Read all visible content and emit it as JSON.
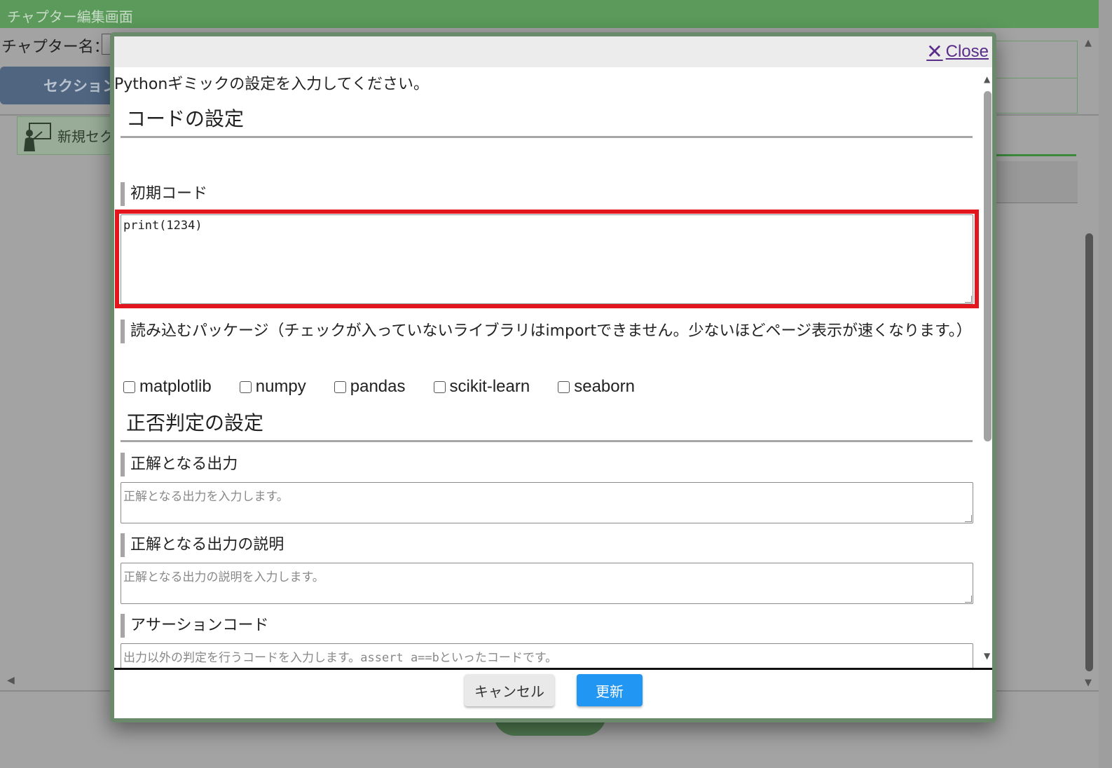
{
  "background": {
    "title": "チャプター編集画面",
    "chapter_name_label": "チャプター名：",
    "section_button": "セクション",
    "section_item": "新規セク"
  },
  "modal": {
    "close_label": "Close",
    "intro": "Pythonギミックの設定を入力してください。",
    "code_section": {
      "heading": "コードの設定",
      "initial_code_label": "初期コード",
      "initial_code_value": "print(1234)",
      "packages_label": "読み込むパッケージ（チェックが入っていないライブラリはimportできません。少ないほどページ表示が速くなります。）",
      "packages": [
        {
          "name": "matplotlib",
          "checked": false
        },
        {
          "name": "numpy",
          "checked": false
        },
        {
          "name": "pandas",
          "checked": false
        },
        {
          "name": "scikit-learn",
          "checked": false
        },
        {
          "name": "seaborn",
          "checked": false
        }
      ]
    },
    "judge_section": {
      "heading": "正否判定の設定",
      "expected_output_label": "正解となる出力",
      "expected_output_placeholder": "正解となる出力を入力します。",
      "expected_output_desc_label": "正解となる出力の説明",
      "expected_output_desc_placeholder": "正解となる出力の説明を入力します。",
      "assertion_label": "アサーションコード",
      "assertion_placeholder": "出力以外の判定を行うコードを入力します。assert a==bといったコードです。"
    },
    "footer": {
      "cancel_label": "キャンセル",
      "update_label": "更新"
    }
  },
  "colors": {
    "header_green": "#5b9a5b",
    "highlight_red": "#e3161e",
    "update_blue": "#2196f3"
  }
}
